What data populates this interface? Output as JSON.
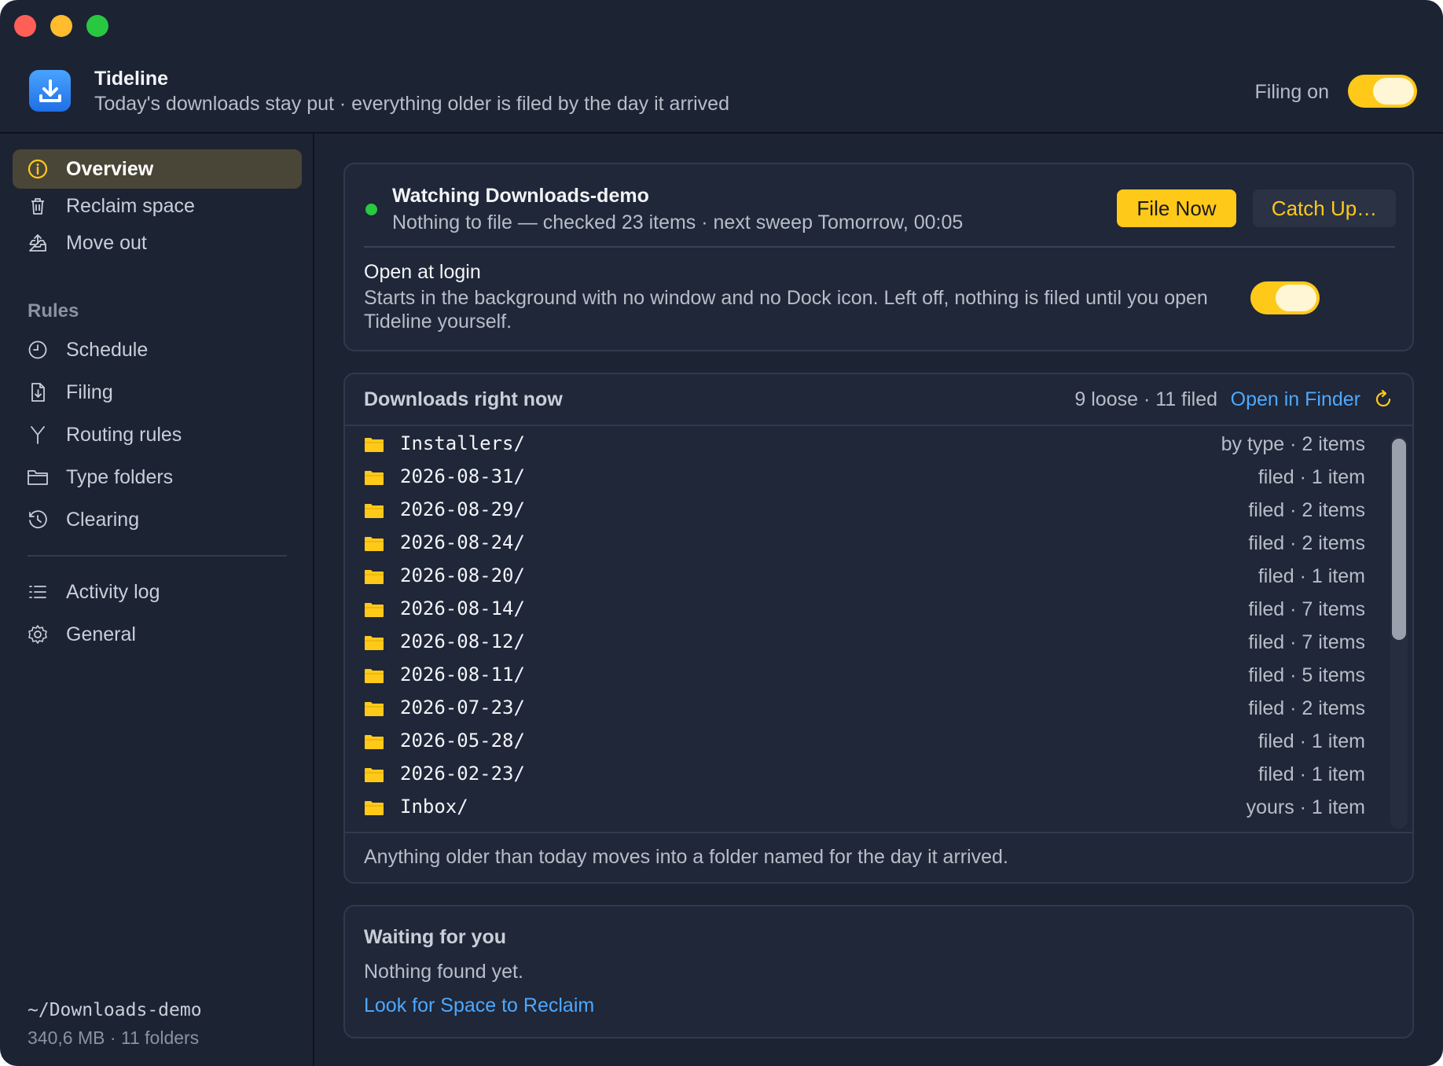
{
  "app": {
    "title": "Tideline",
    "subtitle": "Today's downloads stay put · everything older is filed by the day it arrived",
    "filing_label": "Filing on",
    "filing_on": true
  },
  "colors": {
    "accent": "#ffc91a",
    "link": "#4ea8ff",
    "status_ok": "#28c840",
    "background": "#1c2333"
  },
  "sidebar": {
    "items": [
      {
        "label": "Overview",
        "icon": "info-circle-icon",
        "active": true
      },
      {
        "label": "Reclaim space",
        "icon": "trash-icon"
      },
      {
        "label": "Move out",
        "icon": "tray-upload-icon"
      }
    ],
    "rules_heading": "Rules",
    "rules": [
      {
        "label": "Schedule",
        "icon": "clock-icon"
      },
      {
        "label": "Filing",
        "icon": "document-download-icon"
      },
      {
        "label": "Routing rules",
        "icon": "fork-icon"
      },
      {
        "label": "Type folders",
        "icon": "folder-icon"
      },
      {
        "label": "Clearing",
        "icon": "history-icon"
      }
    ],
    "bottom_items": [
      {
        "label": "Activity log",
        "icon": "list-icon"
      },
      {
        "label": "General",
        "icon": "gear-icon"
      }
    ],
    "path": "~/Downloads-demo",
    "stats": "340,6 MB · 11 folders"
  },
  "status": {
    "title": "Watching Downloads-demo",
    "detail": "Nothing to file — checked 23 items · next sweep Tomorrow, 00:05",
    "file_now": "File Now",
    "catch_up": "Catch Up…",
    "login_title": "Open at login",
    "login_desc": "Starts in the background with no window and no Dock icon. Left off, nothing is filed until you open Tideline yourself.",
    "login_on": true
  },
  "downloads": {
    "title": "Downloads right now",
    "counts": "9 loose · 11 filed",
    "open_label": "Open in Finder",
    "rows": [
      {
        "name": "Installers/",
        "meta": "by type · 2 items"
      },
      {
        "name": "2026-08-31/",
        "meta": "filed · 1 item"
      },
      {
        "name": "2026-08-29/",
        "meta": "filed · 2 items"
      },
      {
        "name": "2026-08-24/",
        "meta": "filed · 2 items"
      },
      {
        "name": "2026-08-20/",
        "meta": "filed · 1 item"
      },
      {
        "name": "2026-08-14/",
        "meta": "filed · 7 items"
      },
      {
        "name": "2026-08-12/",
        "meta": "filed · 7 items"
      },
      {
        "name": "2026-08-11/",
        "meta": "filed · 5 items"
      },
      {
        "name": "2026-07-23/",
        "meta": "filed · 2 items"
      },
      {
        "name": "2026-05-28/",
        "meta": "filed · 1 item"
      },
      {
        "name": "2026-02-23/",
        "meta": "filed · 1 item"
      },
      {
        "name": "Inbox/",
        "meta": "yours · 1 item"
      }
    ],
    "footer": "Anything older than today moves into a folder named for the day it arrived."
  },
  "waiting": {
    "title": "Waiting for you",
    "text": "Nothing found yet.",
    "link": "Look for Space to Reclaim"
  }
}
